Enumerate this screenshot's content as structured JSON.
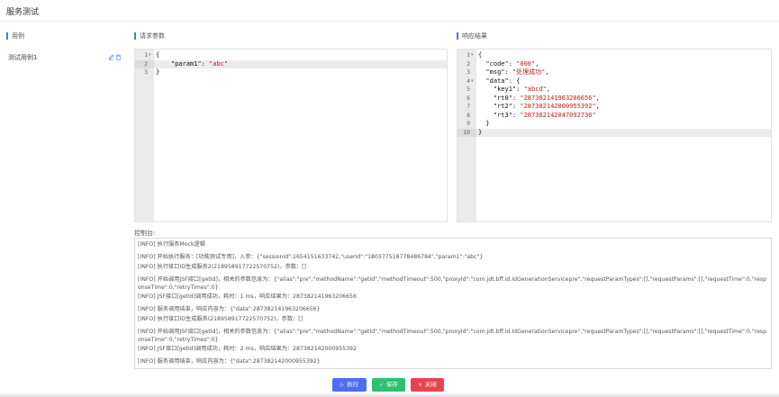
{
  "page": {
    "title": "服务测试"
  },
  "sections": {
    "cases": "用例",
    "request": "请求参数",
    "response": "响应结果",
    "console": "控制台:"
  },
  "cases": [
    {
      "name": "测试用例1"
    }
  ],
  "request_editor": {
    "gutter": [
      "1",
      "2",
      "3"
    ],
    "active_line": 2,
    "lines": [
      [
        [
          "punc",
          "{"
        ]
      ],
      [
        [
          "key",
          "    \"param1\""
        ],
        [
          "punc",
          ": "
        ],
        [
          "str",
          "\"abc\""
        ]
      ],
      [
        [
          "punc",
          "}"
        ]
      ]
    ]
  },
  "response_editor": {
    "gutter": [
      "1",
      "2",
      "3",
      "4",
      "5",
      "6",
      "7",
      "8",
      "9",
      "10"
    ],
    "active_line": 10,
    "lines": [
      [
        [
          "punc",
          "{"
        ]
      ],
      [
        [
          "key",
          "  \"code\""
        ],
        [
          "punc",
          ": "
        ],
        [
          "str",
          "\"000\""
        ],
        [
          "punc",
          ","
        ]
      ],
      [
        [
          "key",
          "  \"msg\""
        ],
        [
          "punc",
          ": "
        ],
        [
          "str",
          "\"处理成功\""
        ],
        [
          "punc",
          ","
        ]
      ],
      [
        [
          "key",
          "  \"data\""
        ],
        [
          "punc",
          ": {"
        ]
      ],
      [
        [
          "key",
          "    \"key1\""
        ],
        [
          "punc",
          ": "
        ],
        [
          "str",
          "\"abcd\""
        ],
        [
          "punc",
          ","
        ]
      ],
      [
        [
          "key",
          "    \"rt0\""
        ],
        [
          "punc",
          ": "
        ],
        [
          "str",
          "\"287382141963206656\""
        ],
        [
          "punc",
          ","
        ]
      ],
      [
        [
          "key",
          "    \"rt2\""
        ],
        [
          "punc",
          ": "
        ],
        [
          "str",
          "\"287382142000955392\""
        ],
        [
          "punc",
          ","
        ]
      ],
      [
        [
          "key",
          "    \"rt3\""
        ],
        [
          "punc",
          ": "
        ],
        [
          "str",
          "\"287382142047092736\""
        ]
      ],
      [
        [
          "punc",
          "  }"
        ]
      ],
      [
        [
          "punc",
          "}"
        ]
      ]
    ]
  },
  "console_logs": [
    "[INFO] 执行服务Mock逻辑",
    "[INFO] 开始执行服务：[功能测试专用]，入参：{\"sessionId\":1654151633742,\"userId\":\"180377518778486784\",\"param1\":\"abc\"}",
    "[INFO] 执行接口ID生成服务2(218958917722570752)，参数：[]",
    "[INFO] 开始调用JSF接口[getId]，相关的参数信息为：{\"alias\":\"pre\",\"methodName\":\"getId\",\"methodTimeout\":500,\"proxyId\":\"com.jdt.bff.id.IdGenerationServicepre\",\"requestParamTypes\":[],\"requestParams\":[],\"requestTime\":0,\"responseTime\":0,\"retryTimes\":0}",
    "[INFO] JSF接口[getId]调用成功，耗时：1 ms，响应结果为：287382141963206656",
    "[INFO] 服务调用结束，响应内容为：{\"data\":287382141963206656}",
    "[INFO] 执行接口ID生成服务(218958917722570752)，参数：[]",
    "[INFO] 开始调用JSF接口[getId]，相关的参数信息为：{\"alias\":\"pre\",\"methodName\":\"getId\",\"methodTimeout\":500,\"proxyId\":\"com.jdt.bff.id.IdGenerationServicepre\",\"requestParamTypes\":[],\"requestParams\":[],\"requestTime\":0,\"responseTime\":0,\"retryTimes\":0}",
    "[INFO] JSF接口[getId]调用成功，耗时：2 ms，响应结果为：287382142000955392",
    "[INFO] 服务调用结束，响应内容为：{\"data\":287382142000955392}"
  ],
  "buttons": {
    "run": {
      "icon": "play-icon",
      "glyph": "▷",
      "label": "执行"
    },
    "save": {
      "icon": "check-icon",
      "glyph": "✓",
      "label": "保存"
    },
    "close": {
      "icon": "close-icon",
      "glyph": "✕",
      "label": "关闭"
    }
  },
  "colors": {
    "run": "#4e6ef2",
    "save": "#2fbf71",
    "close": "#e64550",
    "string": "#c41a16"
  }
}
